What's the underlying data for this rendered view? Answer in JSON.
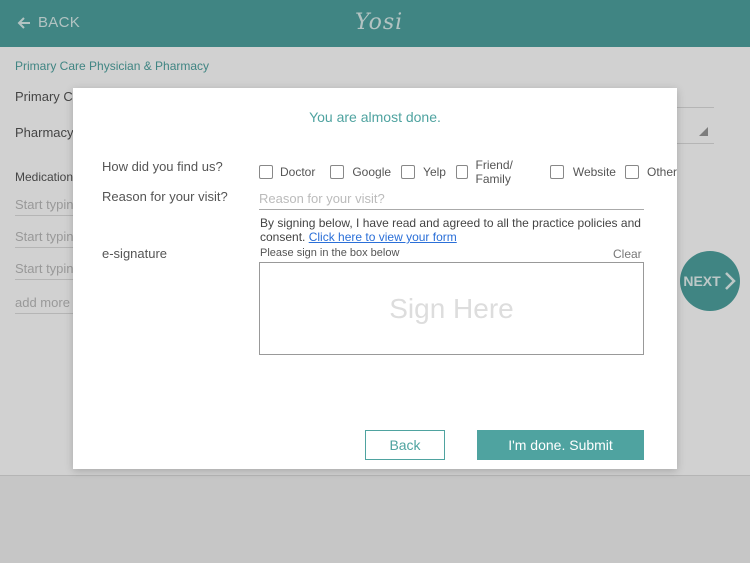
{
  "header": {
    "back_label": "BACK",
    "logo_text": "Yosi"
  },
  "background": {
    "section_title": "Primary Care Physician & Pharmacy",
    "primary_care_label": "Primary Ca",
    "pharmacy_label": "Pharmacy",
    "medication_label": "Medication",
    "med_placeholders": [
      "Start typin",
      "Start typin",
      "Start typin"
    ],
    "add_more_label": "add more",
    "next_label": "NEXT"
  },
  "modal": {
    "title": "You are almost done.",
    "find_us_label": "How did you find us?",
    "find_us_options": [
      "Doctor",
      "Google",
      "Yelp",
      "Friend/ Family",
      "Website",
      "Other"
    ],
    "reason_label": "Reason for your visit?",
    "reason_placeholder": "Reason for your visit?",
    "reason_value": "",
    "consent_text": "By signing below, I have read and agreed to all the practice policies and consent.",
    "consent_link": "Click here to view your form",
    "esignature_label": "e-signature",
    "sign_instruction": "Please sign in the box below",
    "clear_label": "Clear",
    "sign_here": "Sign Here",
    "back_button": "Back",
    "submit_button": "I'm done. Submit"
  },
  "colors": {
    "accent": "#4fa3a0",
    "link": "#2a6fd8"
  }
}
